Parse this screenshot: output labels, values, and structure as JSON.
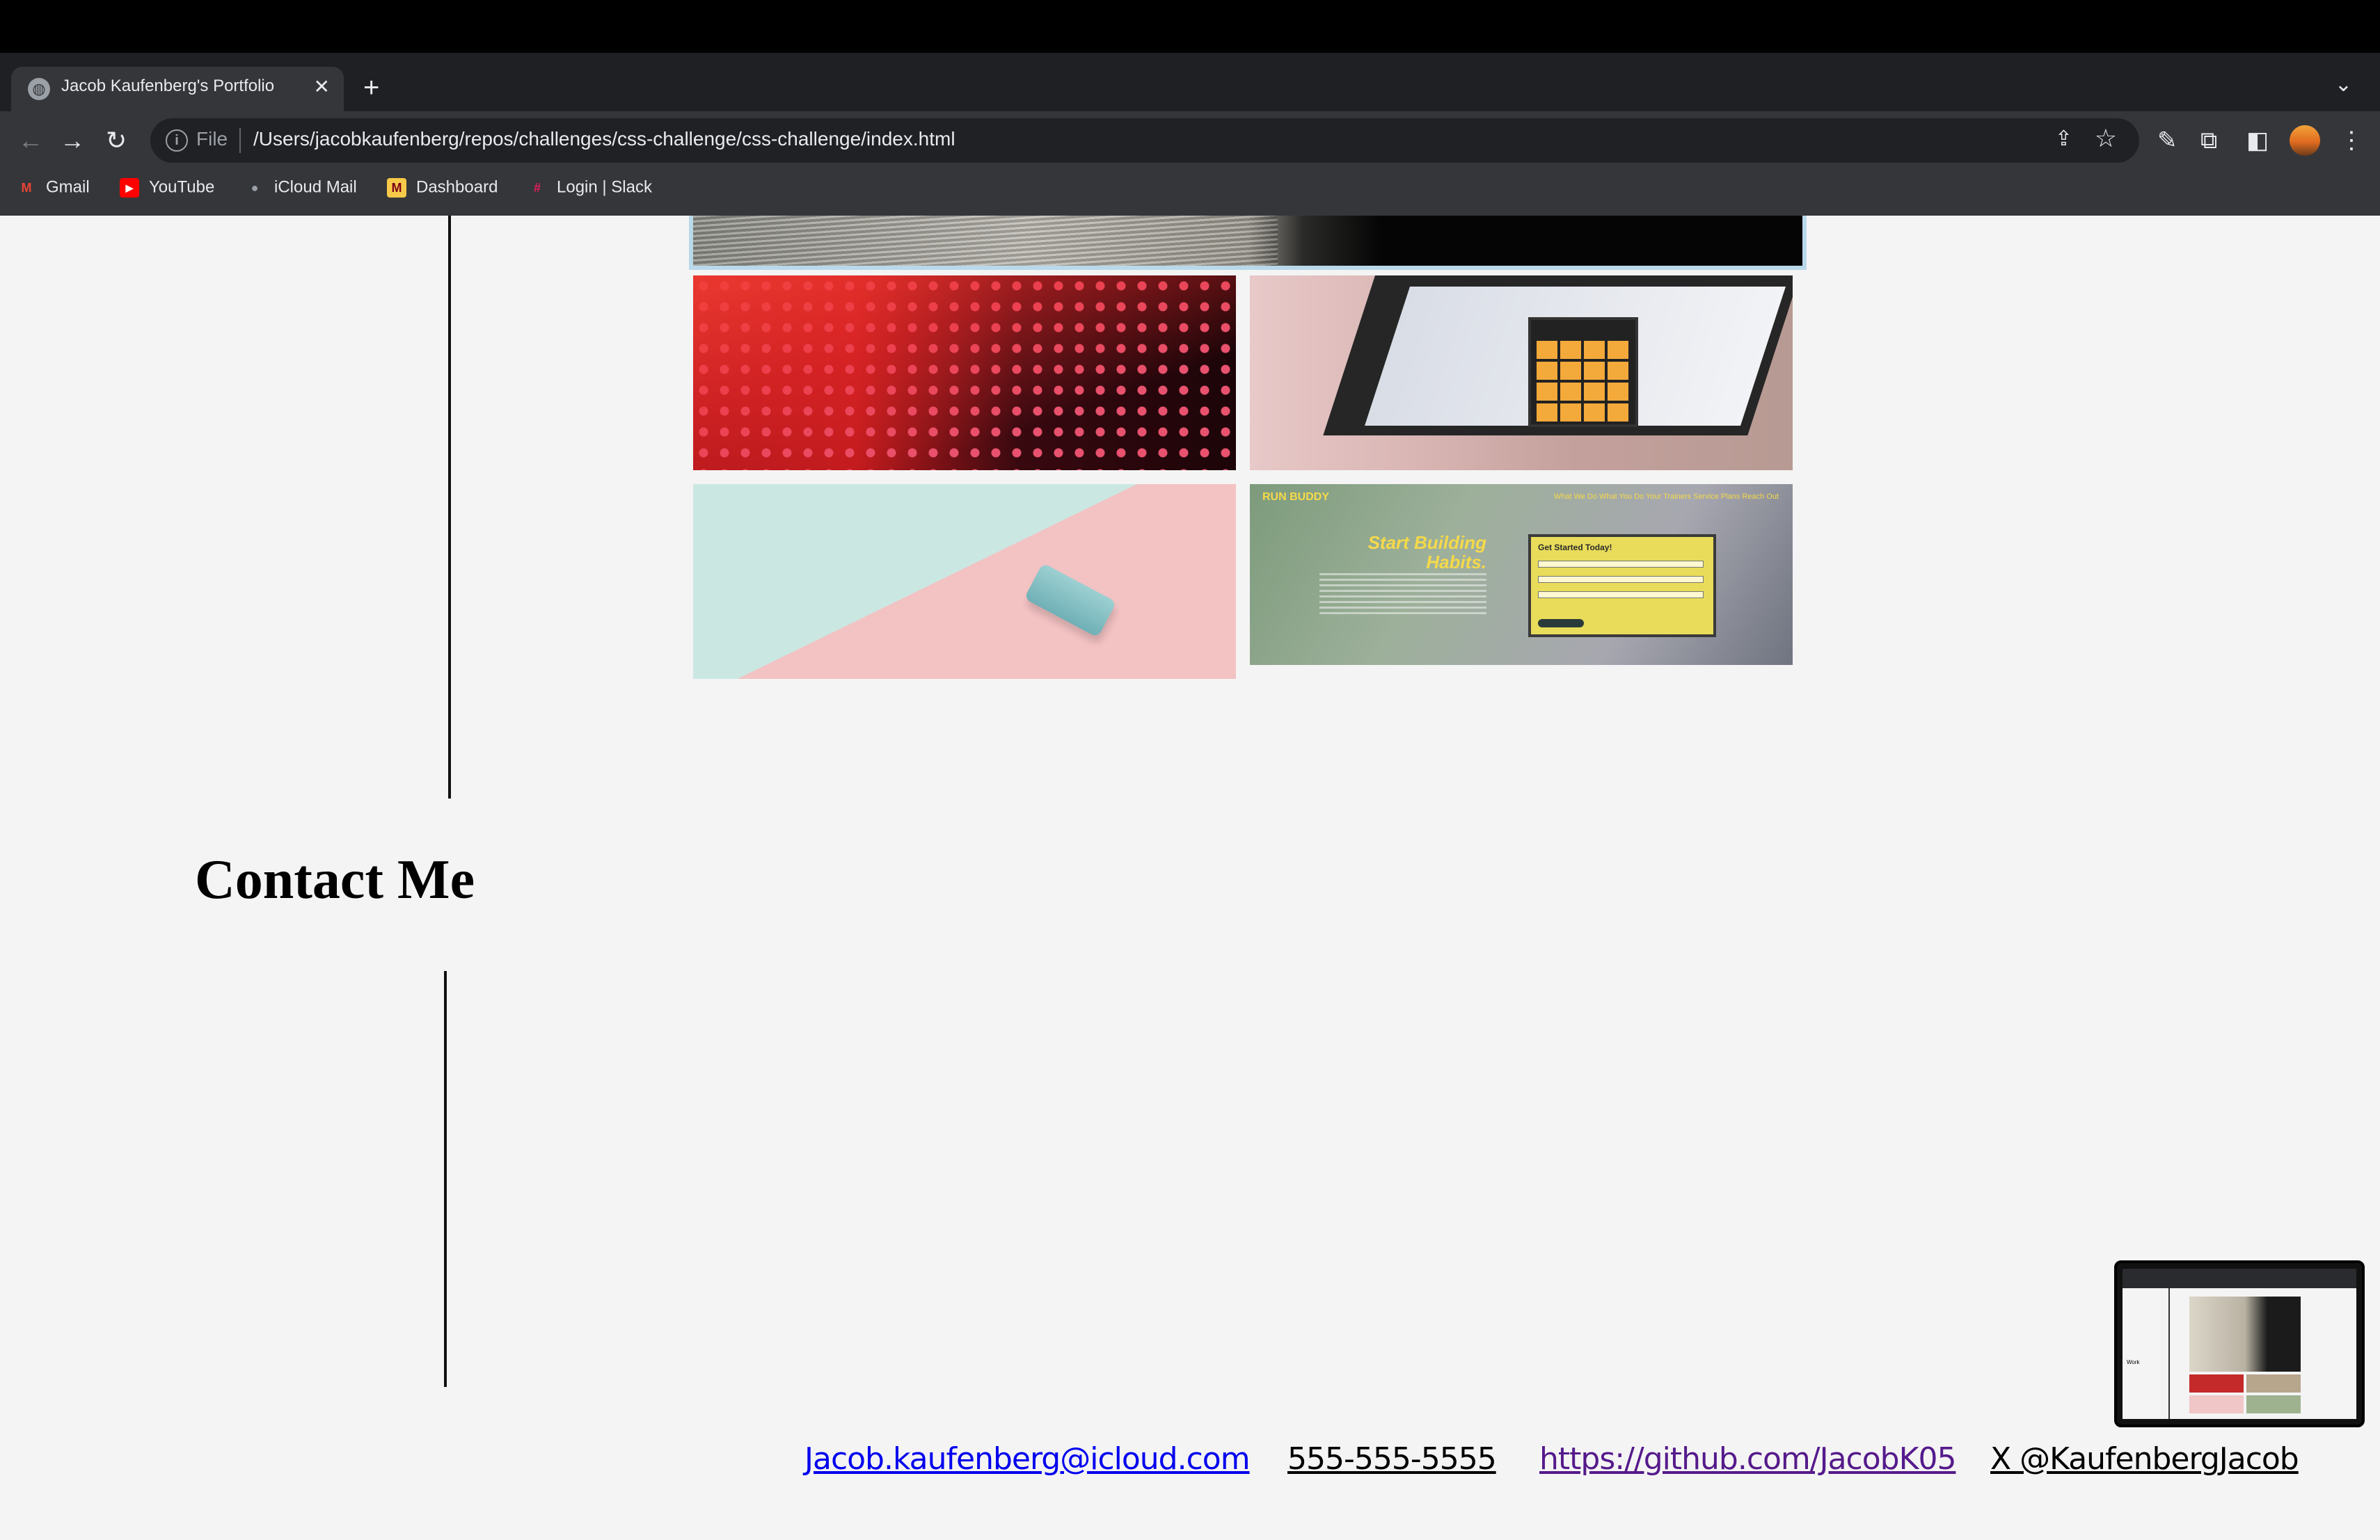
{
  "browser": {
    "tab_title": "Jacob Kaufenberg's Portfolio",
    "tab_close": "✕",
    "new_tab": "+",
    "tab_menu": "⌄",
    "url_scheme": "File",
    "url": "/Users/jacobkaufenberg/repos/challenges/css-challenge/css-challenge/index.html",
    "bookmarks": [
      {
        "label": "Gmail",
        "icon": "gmail-icon",
        "glyph": "M",
        "color": "#ea4335"
      },
      {
        "label": "YouTube",
        "icon": "youtube-icon",
        "glyph": "▶",
        "color": "#ff0000"
      },
      {
        "label": "iCloud Mail",
        "icon": "apple-icon",
        "glyph": "",
        "color": "#9aa0a6"
      },
      {
        "label": "Dashboard",
        "icon": "dashboard-icon",
        "glyph": "M",
        "color": "#f7c948"
      },
      {
        "label": "Login | Slack",
        "icon": "slack-icon",
        "glyph": "#",
        "color": "#e01e5a"
      }
    ]
  },
  "page": {
    "contact_heading": "Contact Me",
    "contact_links": {
      "email": "Jacob.kaufenberg@icloud.com",
      "phone": "555-555-5555",
      "github": "https://github.com/JacobK05",
      "twitter": "X @KaufenbergJacob"
    },
    "colors": {
      "email_link": "#0000ee",
      "phone_link": "#000000",
      "github_link": "#551a8b",
      "twitter_link": "#000000"
    },
    "work_thumbnails": [
      {
        "name": "led-wall-project",
        "alt": ""
      },
      {
        "name": "calculator-project",
        "alt": ""
      },
      {
        "name": "phone-project",
        "alt": ""
      },
      {
        "name": "run-buddy-project",
        "alt": ""
      }
    ],
    "run_buddy": {
      "brand": "RUN BUDDY",
      "nav": "What We Do   What You Do   Your Trainers   Service Plans   Reach Out",
      "hero": "Start Building Habits.",
      "form_title": "Get Started Today!"
    }
  },
  "pip": {
    "label": "Work"
  }
}
